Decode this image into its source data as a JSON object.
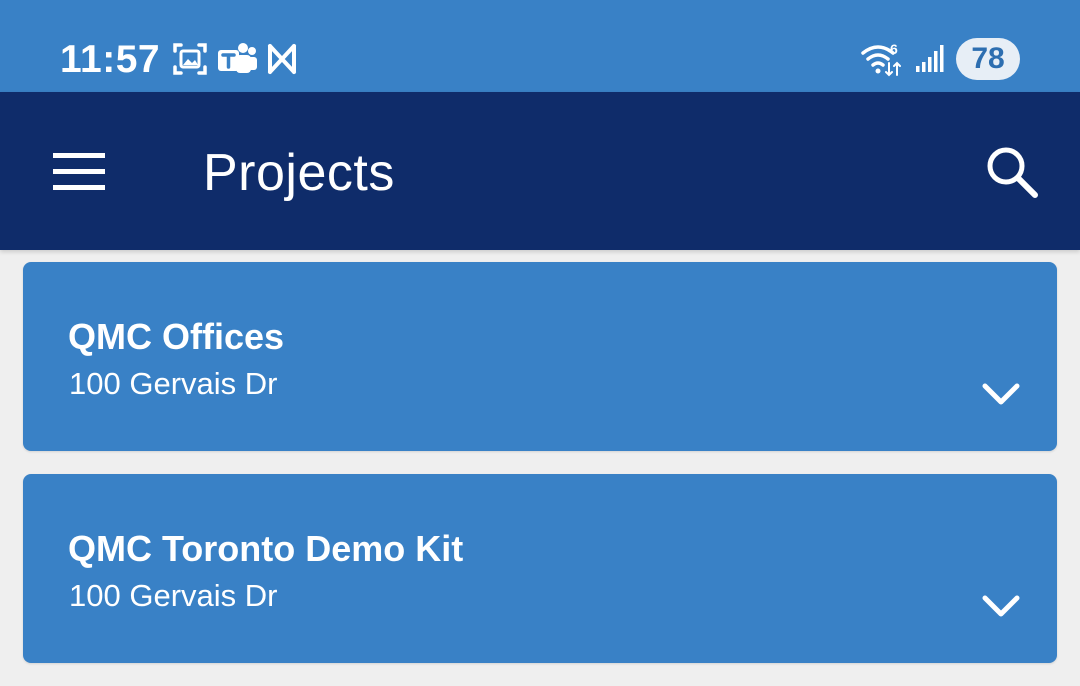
{
  "status_bar": {
    "time": "11:57",
    "battery": "78",
    "icons": [
      "screenshot-icon",
      "teams-icon",
      "app-icon",
      "wifi-6-icon",
      "cellular-signal-icon",
      "battery-icon"
    ]
  },
  "app_bar": {
    "title": "Projects",
    "menu_icon": "hamburger-menu-icon",
    "search_icon": "search-icon"
  },
  "projects": [
    {
      "name": "QMC Offices",
      "address": "100 Gervais Dr",
      "expand_icon": "chevron-down-icon"
    },
    {
      "name": "QMC Toronto Demo Kit",
      "address": "100 Gervais Dr",
      "expand_icon": "chevron-down-icon"
    }
  ],
  "colors": {
    "status_bar": "#3981c6",
    "app_bar": "#0f2c6a",
    "card": "#3981c6",
    "background": "#efefef",
    "text": "#ffffff"
  }
}
